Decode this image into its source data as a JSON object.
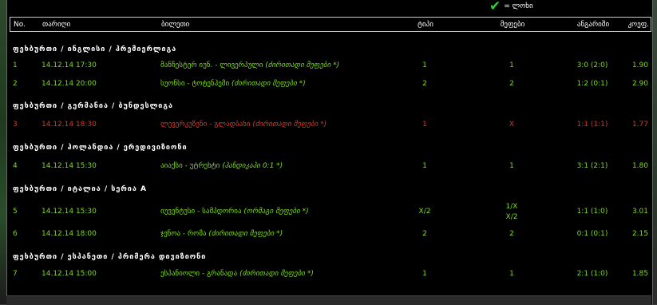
{
  "legend": {
    "label": "= ლოხი",
    "colors": {
      "check": "#2fd12f",
      "win": "#7cdc1c",
      "lose": "#d23b2b"
    }
  },
  "header": {
    "no": "No.",
    "date": "თარიღი",
    "match": "ბილეთი",
    "type": "ტიპი",
    "bet": "მეფები",
    "score": "ანგარიში",
    "odds": "კოეფ."
  },
  "groups": [
    {
      "category": "ფეხბურთი / ინგლისი / პრემიერლიგა",
      "rows": [
        {
          "no": "1",
          "date": "14.12.14 17:30",
          "match": "მანჩესტერ იუნ. - ლივერპული",
          "note": "(ძირითადი მეფები *)",
          "type": "1",
          "bet": "1",
          "score": "3:0 (2:0)",
          "odds": "1.90",
          "status": "win"
        },
        {
          "no": "2",
          "date": "14.12.14 20:00",
          "match": "სუონსი - ტოტენჰემი",
          "note": "(ძირითადი მეფები *)",
          "type": "2",
          "bet": "2",
          "score": "1:2 (0:1)",
          "odds": "2.90",
          "status": "win"
        }
      ]
    },
    {
      "category": "ფეხბურთი / გერმანია / ბუნდესლიგა",
      "rows": [
        {
          "no": "3",
          "date": "14.12.14 18:30",
          "match": "ლევერკუზენი - გლადბახი",
          "note": "(ძირითადი მეფები *)",
          "type": "1",
          "bet": "X",
          "score": "1:1 (1:1)",
          "odds": "1.77",
          "status": "lose"
        }
      ]
    },
    {
      "category": "ფეხბურთი / ჰოლანდია / ერედივიზიონი",
      "rows": [
        {
          "no": "4",
          "date": "14.12.14 15:30",
          "match": "აიაქსი - უტრეხტი",
          "note": "(ჰანდიკაპი 0:1 *)",
          "type": "1",
          "bet": "1",
          "score": "3:1 (2:1)",
          "odds": "1.80",
          "status": "win"
        }
      ]
    },
    {
      "category": "ფეხბურთი / იტალია / სერია A",
      "rows": [
        {
          "no": "5",
          "date": "14.12.14 15:30",
          "match": "იუვენტუსი - სამპდორია",
          "note": "(ორმაგი მეფები *)",
          "type": "X/2",
          "bet": "1/X",
          "bet2": "X/2",
          "score": "1:1 (1:0)",
          "odds": "3.01",
          "status": "win"
        },
        {
          "no": "6",
          "date": "14.12.14 18:00",
          "match": "ჯენოა - რომა",
          "note": "(ძირითადი მეფები *)",
          "type": "2",
          "bet": "2",
          "score": "0:1 (0:1)",
          "odds": "2.15",
          "status": "win"
        }
      ]
    },
    {
      "category": "ფეხბურთი / ესპანეთი / პრიმერა დივიზიონი",
      "rows": [
        {
          "no": "7",
          "date": "14.12.14 15:00",
          "match": "ესპანიოლი - გრანადა",
          "note": "(ძირითადი მეფები *)",
          "type": "1",
          "bet": "1",
          "score": "2:1 (1:0)",
          "odds": "1.85",
          "status": "win"
        }
      ]
    }
  ]
}
